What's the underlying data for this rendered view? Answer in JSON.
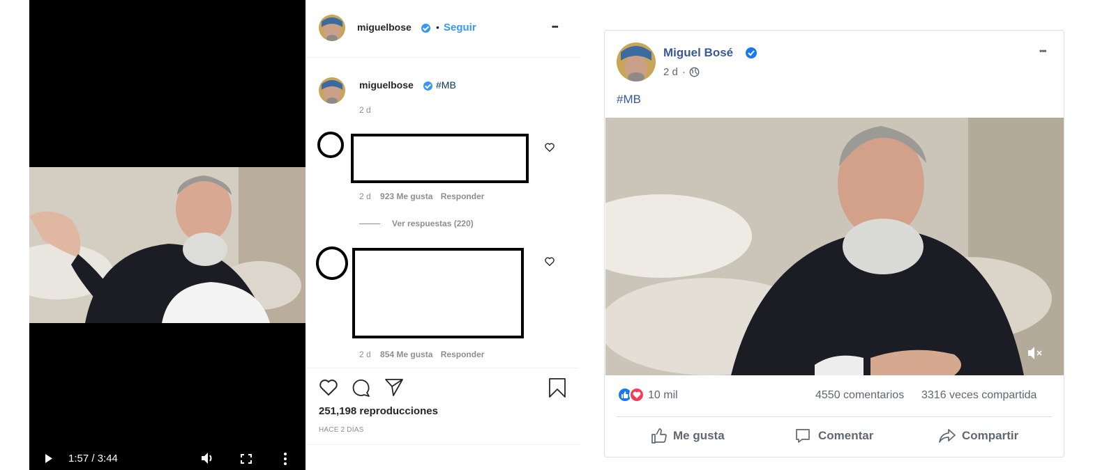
{
  "video_player": {
    "time": "1:57 / 3:44",
    "icons": [
      "play-icon",
      "volume-icon",
      "fullscreen-icon",
      "more-vertical-icon"
    ]
  },
  "instagram": {
    "header": {
      "username": "miguelbose",
      "separator": "•",
      "follow": "Seguir",
      "more": "•••"
    },
    "caption": {
      "username": "miguelbose",
      "text": "#MB",
      "time": "2 d"
    },
    "comments": [
      {
        "time": "2 d",
        "likes": "923 Me gusta",
        "reply": "Responder",
        "view_replies": "Ver respuestas (220)"
      },
      {
        "time": "2 d",
        "likes": "854 Me gusta",
        "reply": "Responder"
      }
    ],
    "views": "251,198 reproducciones",
    "date": "HACE 2 DÍAS"
  },
  "facebook": {
    "name": "Miguel Bosé",
    "time": "2 d",
    "dot": "·",
    "more": "•••",
    "text": "#MB",
    "reactions": "10 mil",
    "comments": "4550 comentarios",
    "shares": "3316 veces compartida",
    "actions": {
      "like": "Me gusta",
      "comment": "Comentar",
      "share": "Compartir"
    },
    "colors": {
      "name": "#385898",
      "like_blue": "#1877f2",
      "love_red": "#f33e58"
    }
  }
}
